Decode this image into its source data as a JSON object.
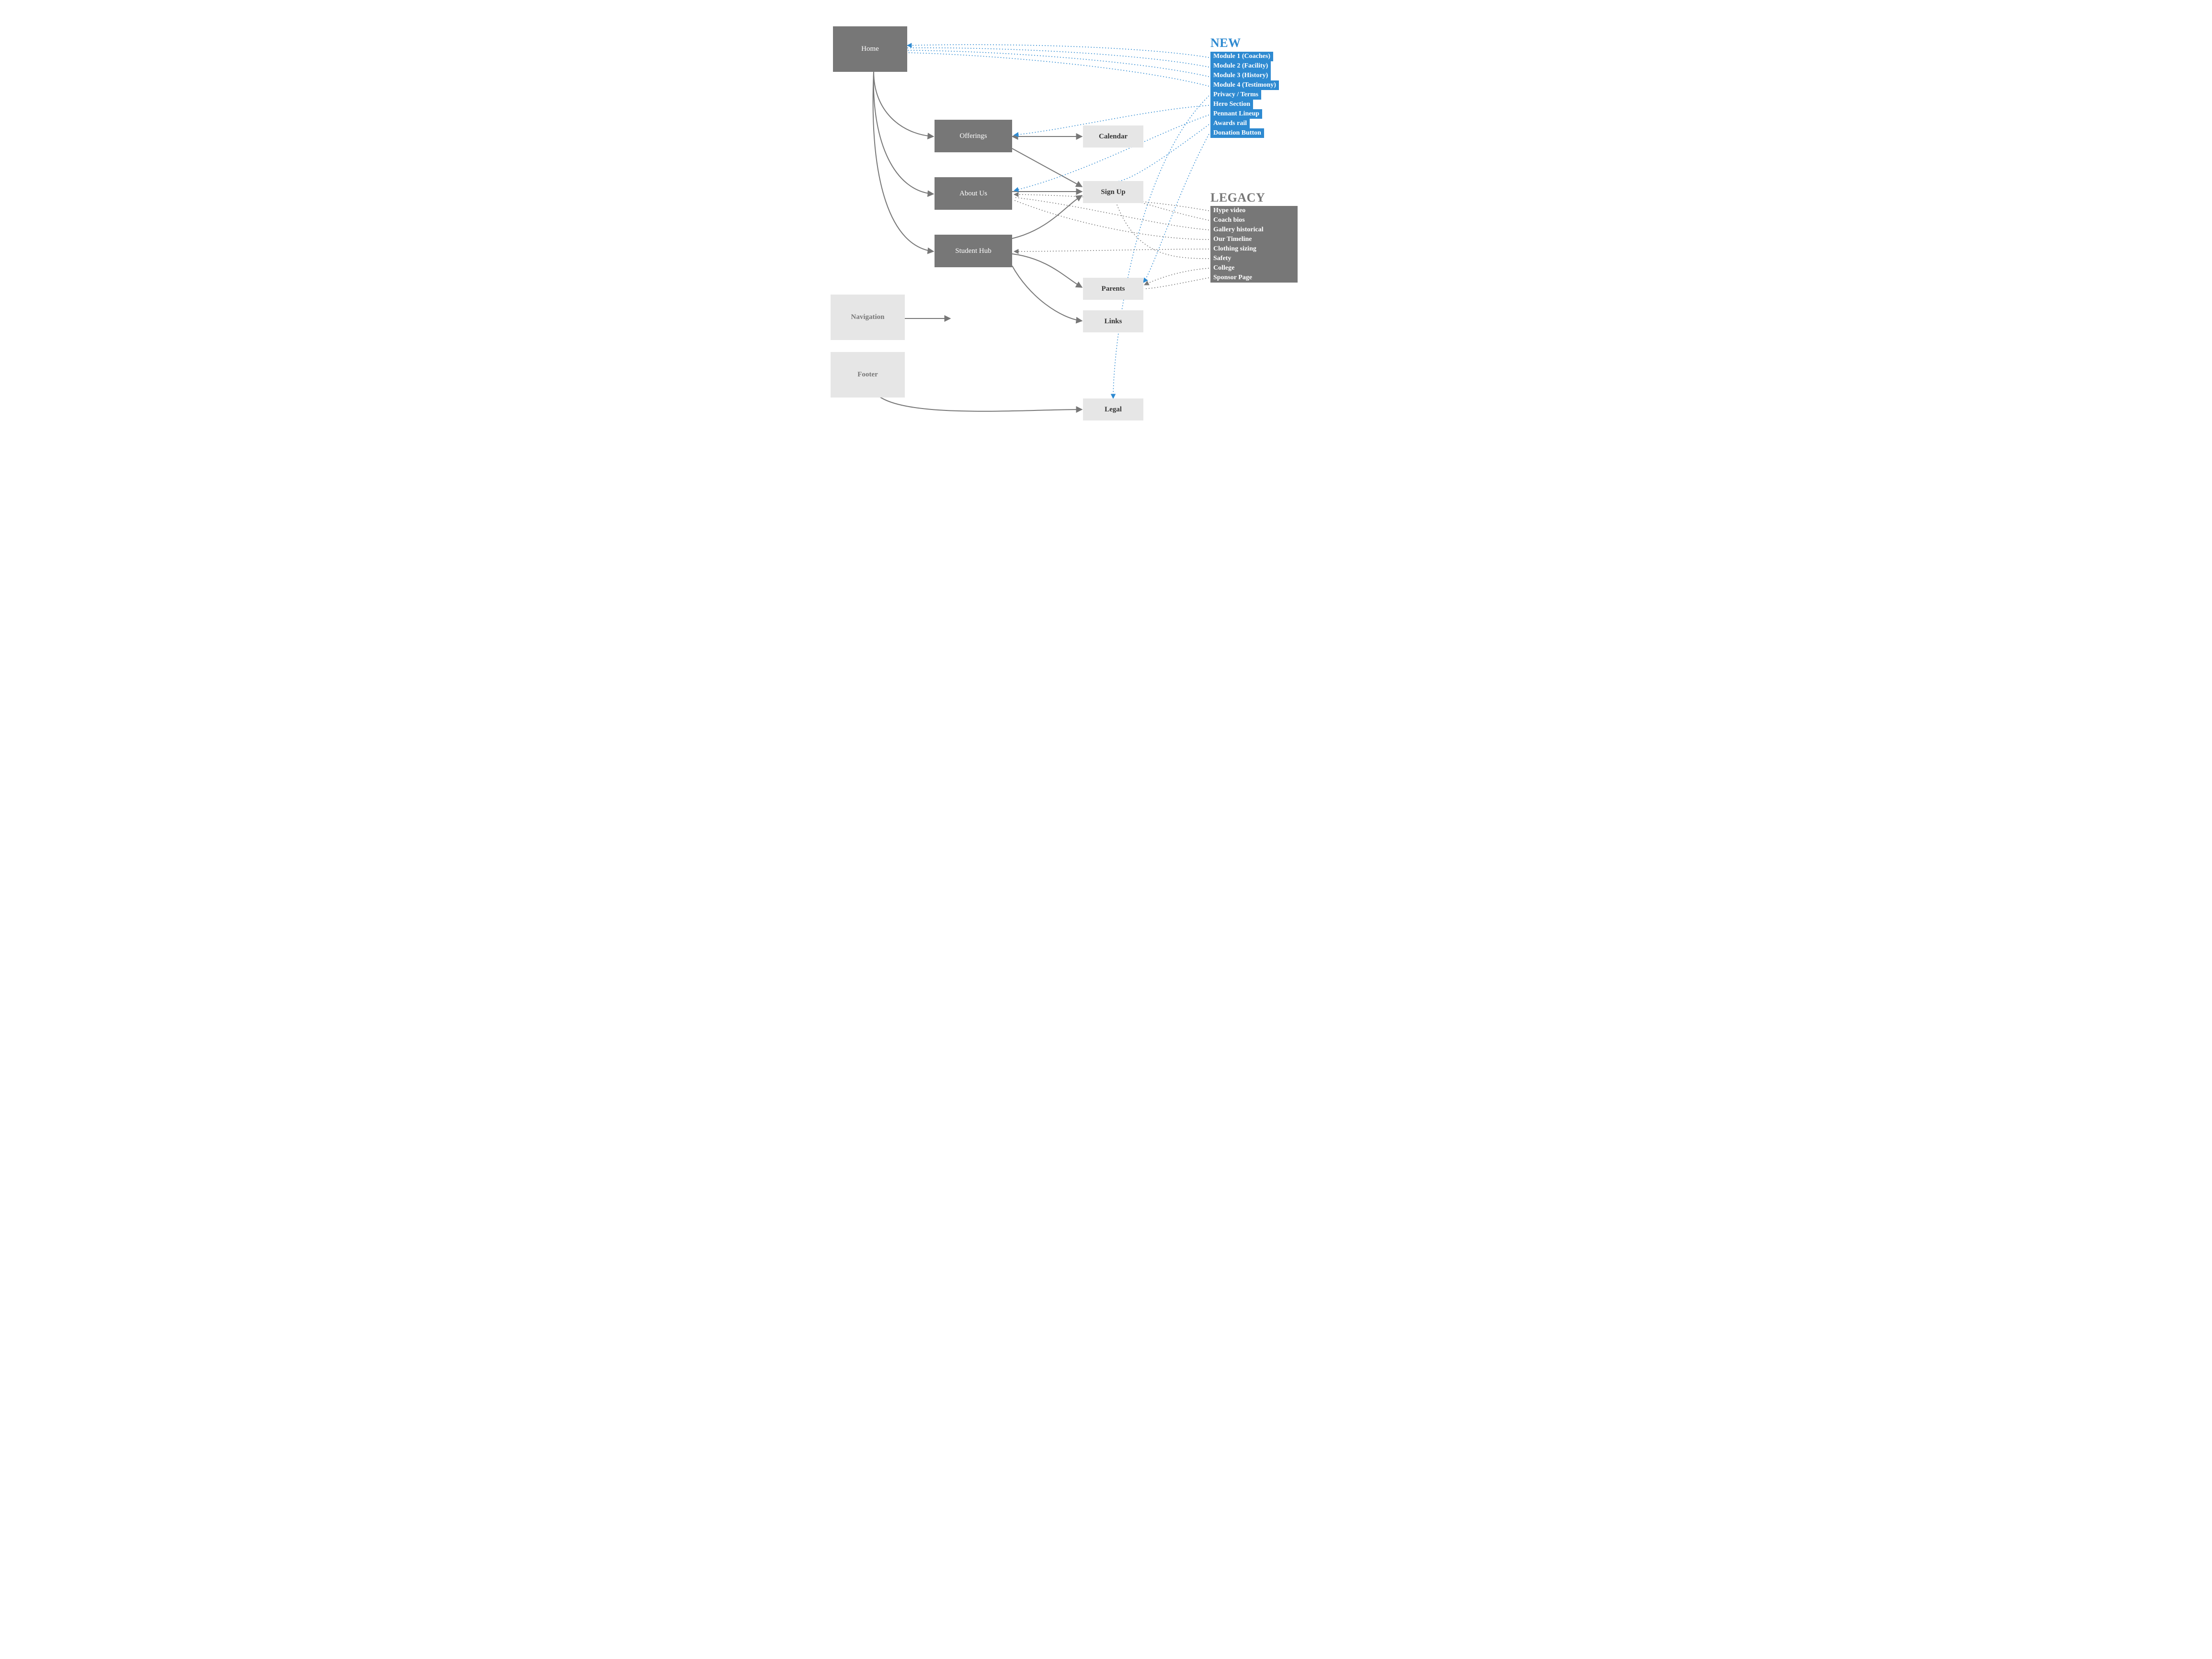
{
  "nodes": {
    "home": "Home",
    "offerings": "Offerings",
    "about": "About Us",
    "student": "Student Hub",
    "navigation": "Navigation",
    "footer": "Footer",
    "calendar": "Calendar",
    "signup": "Sign Up",
    "parents": "Parents",
    "links": "Links",
    "legal": "Legal"
  },
  "new_heading": "NEW",
  "new_items": [
    "Module 1 (Coaches)",
    "Module 2 (Facility)",
    "Module 3 (History)",
    "Module 4 (Testimony)",
    "Privacy / Terms",
    "Hero Section",
    "Pennant Lineup",
    "Awards rail",
    "Donation Button"
  ],
  "legacy_heading": "LEGACY",
  "legacy_items": [
    "Hype video",
    "Coach bios",
    "Gallery historical",
    "Our Timeline",
    "Clothing sizing",
    "Safety",
    "College",
    "Sponsor Page"
  ],
  "colors": {
    "gray_solid": "#777777",
    "gray_dotted": "#777777",
    "blue": "#2e8ad1"
  }
}
